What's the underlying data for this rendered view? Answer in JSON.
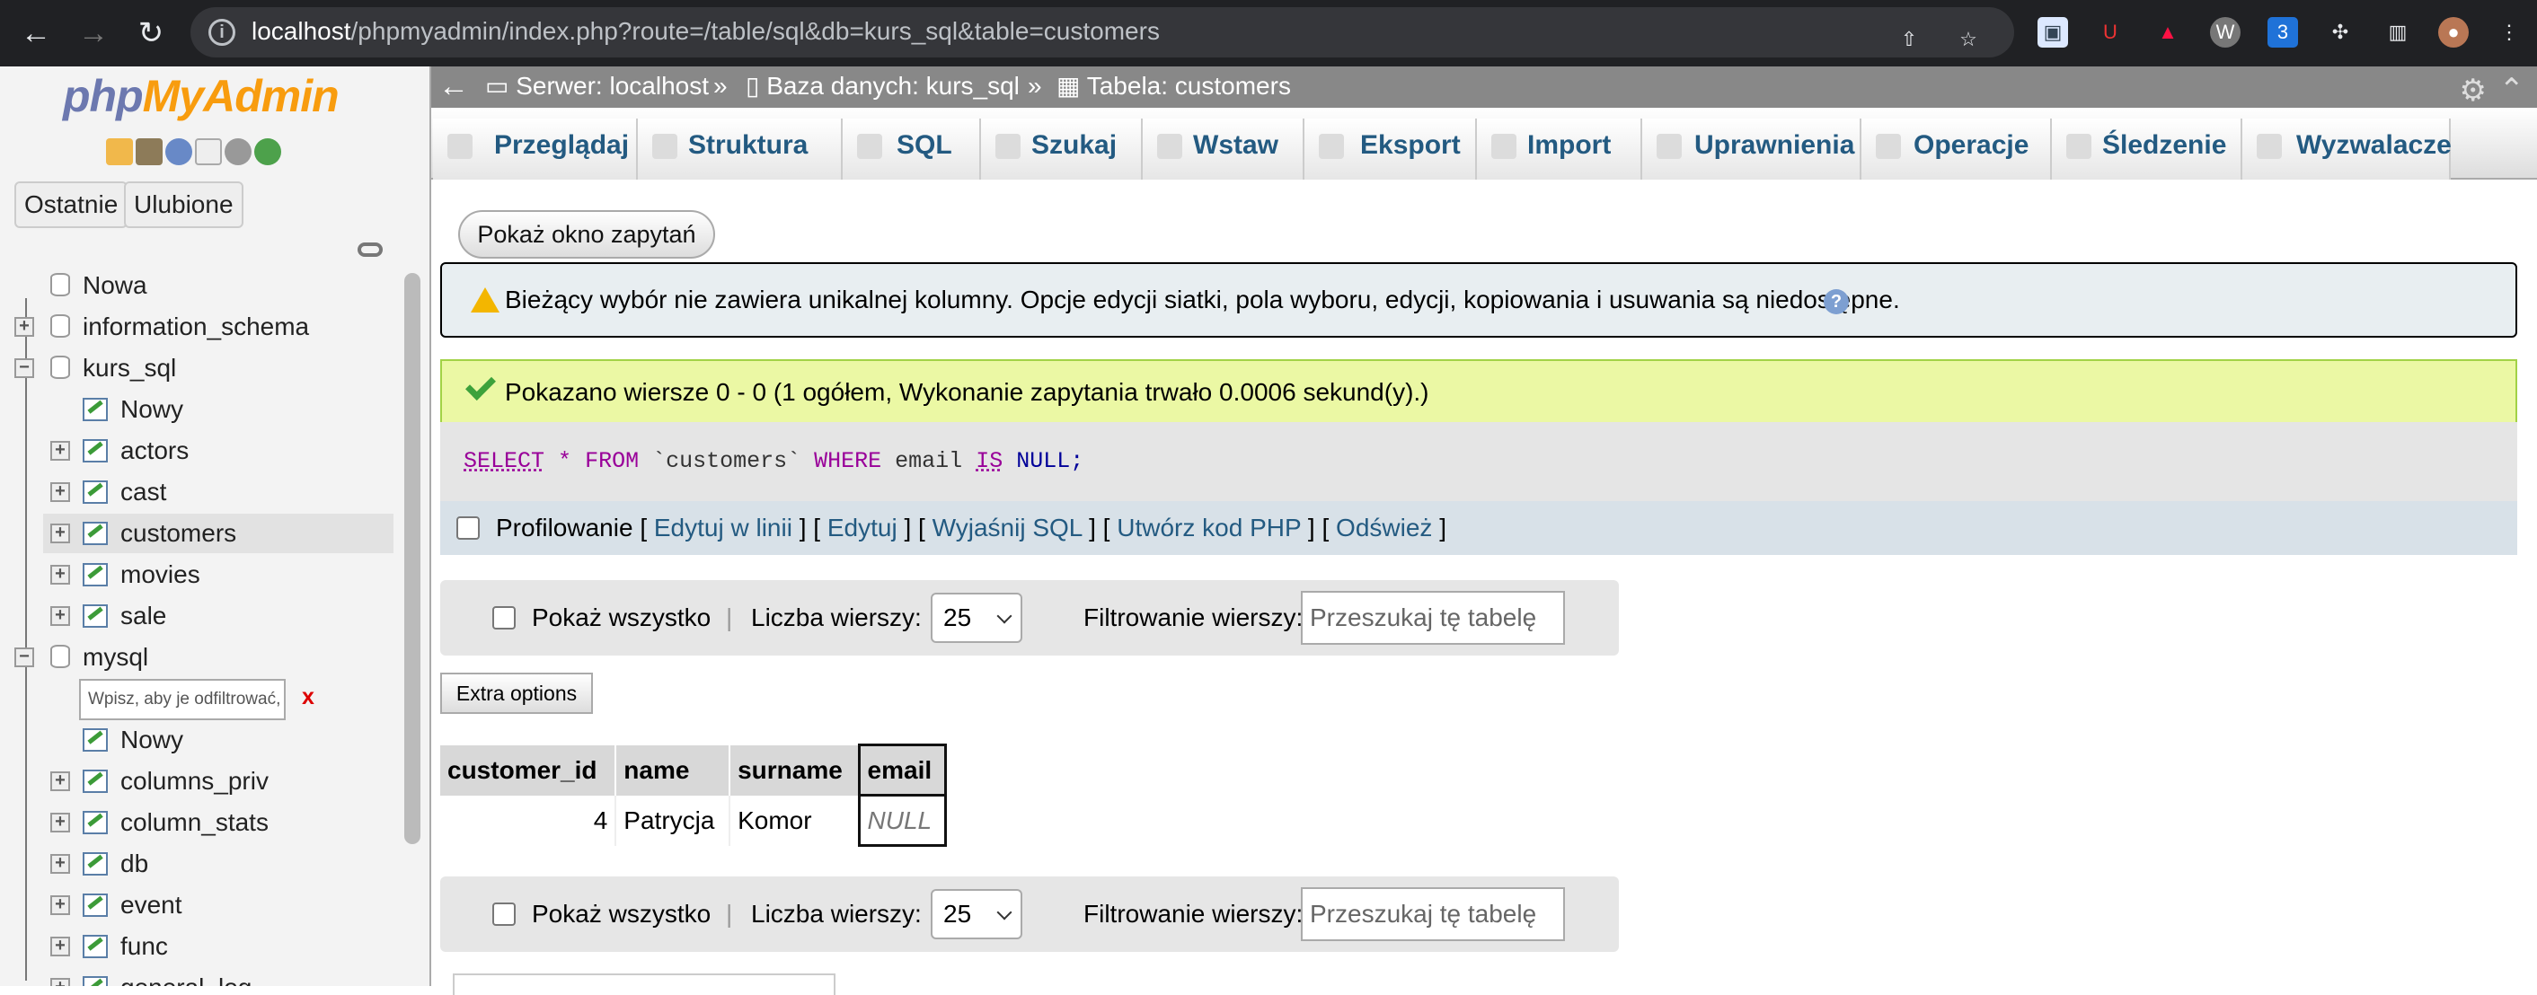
{
  "browser": {
    "url_host": "localhost",
    "url_path": "/phpmyadmin/index.php?route=/table/sql&db=kurs_sql&table=customers"
  },
  "sidebar": {
    "logo_php": "php",
    "logo_myadmin": "MyAdmin",
    "recent_label": "Ostatnie",
    "favorites_label": "Ulubione",
    "filter_placeholder": "Wpisz, aby je odfiltrować,",
    "filter_clear": "x",
    "tree": [
      {
        "label": "Nowa"
      },
      {
        "label": "information_schema"
      },
      {
        "label": "kurs_sql"
      },
      {
        "label": "Nowy"
      },
      {
        "label": "actors"
      },
      {
        "label": "cast"
      },
      {
        "label": "customers"
      },
      {
        "label": "movies"
      },
      {
        "label": "sale"
      },
      {
        "label": "mysql"
      },
      {
        "label": "Nowy"
      },
      {
        "label": "columns_priv"
      },
      {
        "label": "column_stats"
      },
      {
        "label": "db"
      },
      {
        "label": "event"
      },
      {
        "label": "func"
      },
      {
        "label": "general_log"
      }
    ]
  },
  "breadcrumb": {
    "server": "Serwer: localhost",
    "database": "Baza danych: kurs_sql",
    "table": "Tabela: customers",
    "separator": "»"
  },
  "tabs": [
    "Przeglądaj",
    "Struktura",
    "SQL",
    "Szukaj",
    "Wstaw",
    "Eksport",
    "Import",
    "Uprawnienia",
    "Operacje",
    "Śledzenie",
    "Wyzwalacze"
  ],
  "main": {
    "show_query_button": "Pokaż okno zapytań",
    "notice": "Bieżący wybór nie zawiera unikalnej kolumny. Opcje edycji siatki, pola wyboru, edycji, kopiowania i usuwania są niedostępne.",
    "success": "Pokazano wiersze 0 - 0 (1 ogółem, Wykonanie zapytania trwało 0.0006 sekund(y).)",
    "sql": {
      "select": "SELECT",
      "star": "*",
      "from": "FROM",
      "table": "`customers`",
      "where": "WHERE",
      "column": "email",
      "is": "IS",
      "null": "NULL;"
    },
    "profile": {
      "label": "Profilowanie",
      "edit_inline": "Edytuj w linii",
      "edit": "Edytuj",
      "explain": "Wyjaśnij SQL",
      "create_php": "Utwórz kod PHP",
      "refresh": "Odśwież"
    },
    "navigation": {
      "show_all": "Pokaż wszystko",
      "rows_label": "Liczba wierszy:",
      "rows_value": "25",
      "filter_label": "Filtrowanie wierszy:",
      "search_placeholder": "Przeszukaj tę tabelę"
    },
    "extra_options": "Extra options",
    "table": {
      "headers": [
        "customer_id",
        "name",
        "surname",
        "email"
      ],
      "row": [
        "4",
        "Patrycja",
        "Komor",
        "NULL"
      ]
    }
  },
  "colors": {
    "browser_bar": "#202124",
    "link": "#235a81",
    "success": "#ebf8a4",
    "notice": "#e8eef1",
    "server_bar": "#888888"
  },
  "icons": [
    "back-icon",
    "forward-icon",
    "reload-icon",
    "info-icon",
    "share-icon",
    "bookmark-icon",
    "extension-icon",
    "profile-icon",
    "menu-icon"
  ]
}
